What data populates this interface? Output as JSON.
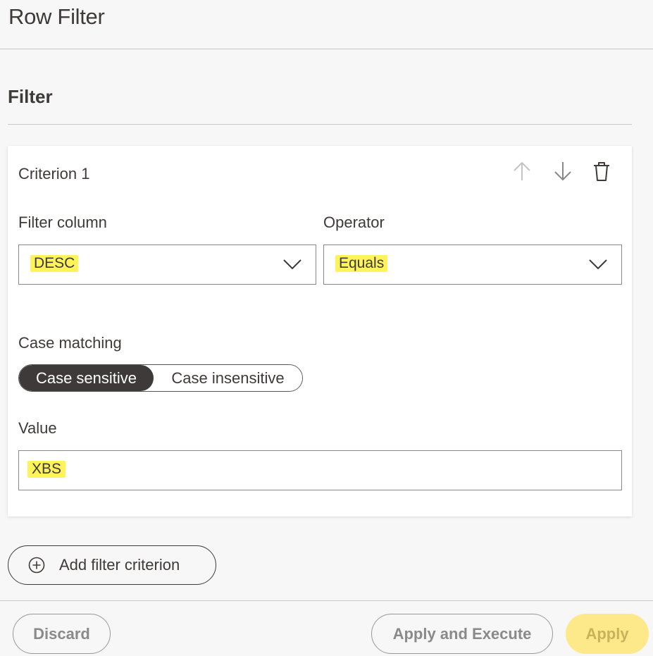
{
  "header": {
    "title": "Row Filter"
  },
  "section": {
    "title": "Filter"
  },
  "criterion": {
    "title": "Criterion 1",
    "icons": [
      "arrow-up-icon",
      "arrow-down-icon",
      "trash-icon"
    ],
    "filter_column": {
      "label": "Filter column",
      "value": "DESC"
    },
    "operator": {
      "label": "Operator",
      "value": "Equals"
    },
    "case_matching": {
      "label": "Case matching",
      "options": [
        "Case sensitive",
        "Case insensitive"
      ],
      "selected": "Case sensitive"
    },
    "value_field": {
      "label": "Value",
      "value": "XBS"
    }
  },
  "add_button": {
    "label": "Add filter criterion",
    "icon": "plus-circle-icon"
  },
  "footer": {
    "discard": "Discard",
    "apply_execute": "Apply and Execute",
    "apply": "Apply"
  },
  "colors": {
    "highlight": "#fff35a",
    "primary_button": "#fde98a",
    "toggle_active": "#3e3a39"
  }
}
